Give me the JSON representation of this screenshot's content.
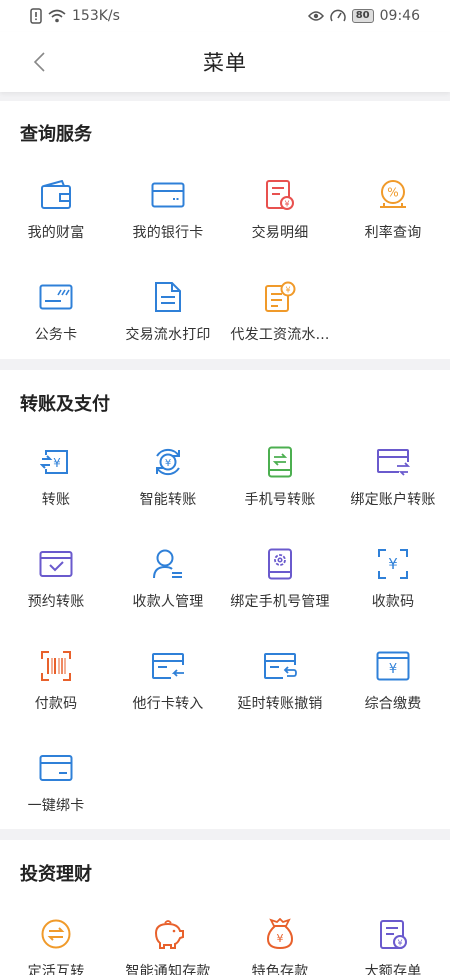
{
  "status_bar": {
    "speed": "153K/s",
    "battery": "80",
    "time": "09:46"
  },
  "header": {
    "title": "菜单"
  },
  "sections": [
    {
      "title": "查询服务",
      "items": [
        {
          "label": "我的财富",
          "icon": "wallet-icon"
        },
        {
          "label": "我的银行卡",
          "icon": "bank-card-icon"
        },
        {
          "label": "交易明细",
          "icon": "transaction-detail-icon"
        },
        {
          "label": "利率查询",
          "icon": "interest-rate-icon"
        },
        {
          "label": "公务卡",
          "icon": "official-card-icon"
        },
        {
          "label": "交易流水打印",
          "icon": "statement-print-icon"
        },
        {
          "label": "代发工资流水...",
          "icon": "payroll-statement-icon"
        }
      ]
    },
    {
      "title": "转账及支付",
      "items": [
        {
          "label": "转账",
          "icon": "transfer-icon"
        },
        {
          "label": "智能转账",
          "icon": "smart-transfer-icon"
        },
        {
          "label": "手机号转账",
          "icon": "phone-transfer-icon"
        },
        {
          "label": "绑定账户转账",
          "icon": "bound-account-transfer-icon"
        },
        {
          "label": "预约转账",
          "icon": "scheduled-transfer-icon"
        },
        {
          "label": "收款人管理",
          "icon": "payee-management-icon"
        },
        {
          "label": "绑定手机号管理",
          "icon": "phone-binding-icon"
        },
        {
          "label": "收款码",
          "icon": "receive-code-icon"
        },
        {
          "label": "付款码",
          "icon": "payment-code-icon"
        },
        {
          "label": "他行卡转入",
          "icon": "other-bank-transfer-in-icon"
        },
        {
          "label": "延时转账撤销",
          "icon": "delayed-transfer-cancel-icon"
        },
        {
          "label": "综合缴费",
          "icon": "bill-payment-icon"
        },
        {
          "label": "一键绑卡",
          "icon": "bind-card-icon"
        }
      ]
    },
    {
      "title": "投资理财",
      "items": [
        {
          "label": "定活互转",
          "icon": "fixed-demand-switch-icon"
        },
        {
          "label": "智能通知存款",
          "icon": "smart-notice-deposit-icon"
        },
        {
          "label": "特色存款",
          "icon": "featured-deposit-icon"
        },
        {
          "label": "大额存单",
          "icon": "large-deposit-certificate-icon"
        }
      ]
    }
  ],
  "colors": {
    "blue": "#2f80d8",
    "red": "#e8514f",
    "orange": "#f09a2a",
    "green": "#4caf50",
    "purple": "#6a5acd",
    "deep_orange": "#e8612c"
  }
}
